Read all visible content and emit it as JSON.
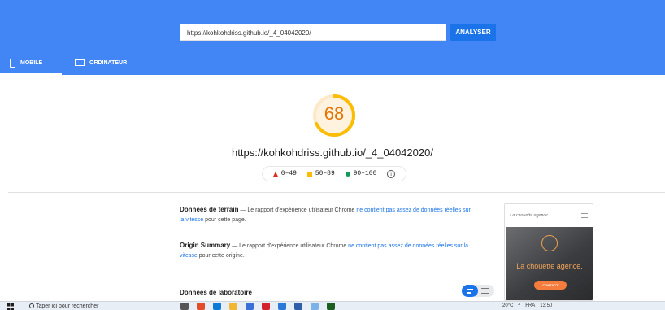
{
  "header": {
    "url_value": "https://kohkohdriss.github.io/_4_04042020/",
    "analyze_label": "ANALYSER",
    "tabs": [
      {
        "label": "MOBILE",
        "icon": "phone-icon",
        "active": true
      },
      {
        "label": "ORDINATEUR",
        "icon": "monitor-icon",
        "active": false
      }
    ],
    "background_color": "#4285f4"
  },
  "score": {
    "value": 68,
    "display": "68",
    "color": "#e37400"
  },
  "page_url": "https://kohkohdriss.github.io/_4_04042020/",
  "legend": [
    {
      "label": "0–49",
      "color": "#d93025",
      "shape": "triangle"
    },
    {
      "label": "50–89",
      "color": "#fbbc04",
      "shape": "square"
    },
    {
      "label": "90–100",
      "color": "#0f9d58",
      "shape": "circle"
    }
  ],
  "field_data": {
    "title": "Données de terrain",
    "text_before": " — Le rapport d'expérience utilisateur Chrome ",
    "link": "ne contient pas assez de données réelles sur la vitesse",
    "text_after": " pour cette page."
  },
  "origin_summary": {
    "title": "Origin Summary",
    "text_before": " — Le rapport d'expérience utilisateur Chrome ",
    "link": "ne contient pas assez de données réelles sur la vitesse",
    "text_after": " pour cette origine."
  },
  "lab_data": {
    "title": "Données de laboratoire"
  },
  "screenshot_preview": {
    "site_title": "La chouette agence",
    "tagline": "La chouette agence.",
    "cta": "CONTACT"
  },
  "taskbar": {
    "search_placeholder": "Taper ici pour rechercher",
    "temperature": "20°C",
    "language": "FRA",
    "time": "13:50"
  }
}
